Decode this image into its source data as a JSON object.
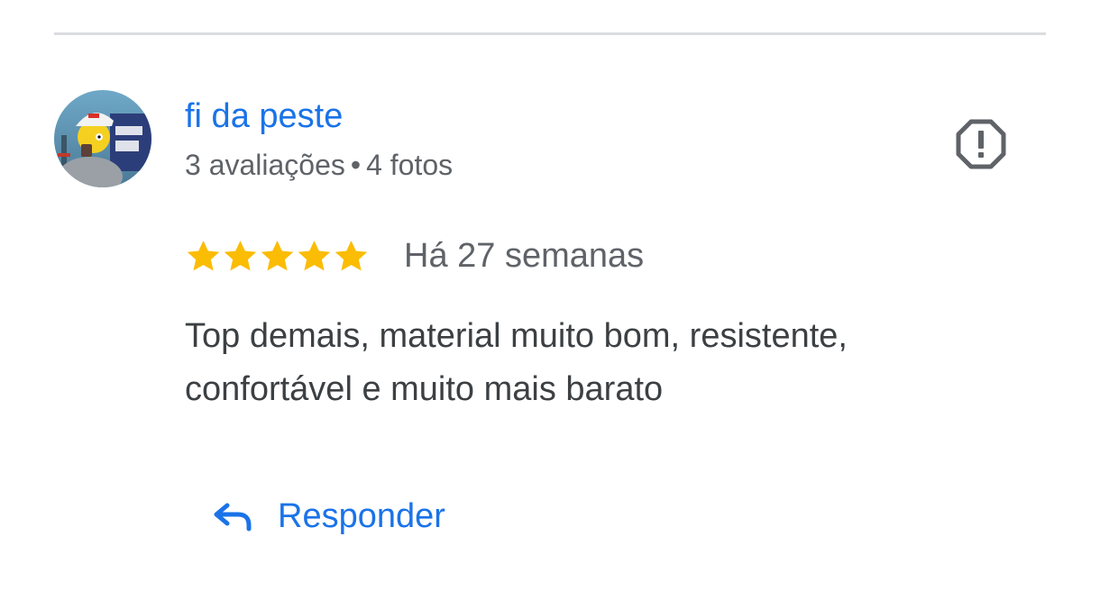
{
  "review": {
    "author": {
      "name": "fi da peste",
      "reviews_count": "3 avaliações",
      "separator": "•",
      "photos_count": "4 fotos",
      "avatar_icon": "avatar-cartoon-character-icon"
    },
    "rating": 5,
    "rating_max": 5,
    "date": "Há 27 semanas",
    "text": "Top demais, material muito bom, resistente, confortável e muito mais barato",
    "report_icon": "report-octagon-icon",
    "reply": {
      "label": "Responder",
      "icon": "reply-arrow-icon"
    }
  },
  "colors": {
    "link_blue": "#1a73e8",
    "star_yellow": "#fbbc04",
    "secondary_text": "#5f6368",
    "primary_text": "#3c4043",
    "divider": "#dadce0"
  }
}
